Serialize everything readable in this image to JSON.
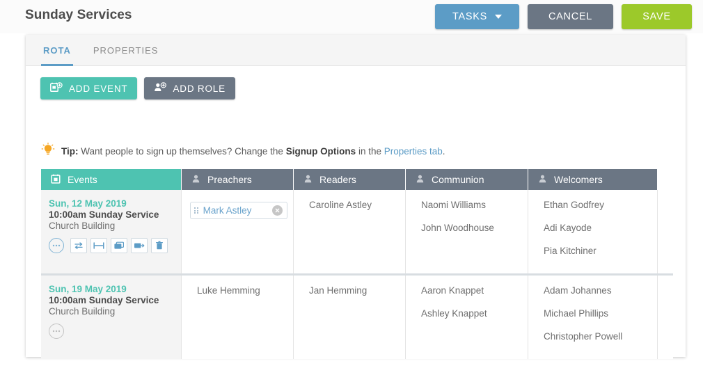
{
  "header": {
    "title": "Sunday Services",
    "buttons": {
      "tasks": "TASKS",
      "cancel": "CANCEL",
      "save": "SAVE"
    }
  },
  "tabs": [
    {
      "label": "ROTA",
      "active": true
    },
    {
      "label": "PROPERTIES",
      "active": false
    }
  ],
  "toolbar": {
    "add_event": "ADD EVENT",
    "add_role": "ADD ROLE"
  },
  "tip": {
    "prefix": "Tip:",
    "text_before": " Want people to sign up themselves? Change the ",
    "bold": "Signup Options",
    "text_middle": " in the ",
    "link": "Properties tab",
    "text_after": "."
  },
  "table": {
    "headers": [
      {
        "label": "Events",
        "icon": "calendar-icon"
      },
      {
        "label": "Preachers",
        "icon": "person-icon"
      },
      {
        "label": "Readers",
        "icon": "person-icon"
      },
      {
        "label": "Communion",
        "icon": "person-icon"
      },
      {
        "label": "Welcomers",
        "icon": "person-icon"
      }
    ],
    "rows": [
      {
        "event": {
          "date": "Sun, 12 May 2019",
          "name": "10:00am Sunday Service",
          "location": "Church Building"
        },
        "preachers_chip": "Mark Astley",
        "readers": [
          "Caroline Astley"
        ],
        "communion": [
          "Naomi Williams",
          "John Woodhouse"
        ],
        "welcomers": [
          "Ethan Godfrey",
          "Adi Kayode",
          "Pia Kitchiner"
        ]
      },
      {
        "event": {
          "date": "Sun, 19 May 2019",
          "name": "10:00am Sunday Service",
          "location": "Church Building"
        },
        "preachers": [
          "Luke Hemming"
        ],
        "readers": [
          "Jan Hemming"
        ],
        "communion": [
          "Aaron Knappet",
          "Ashley Knappet"
        ],
        "welcomers": [
          "Adam Johannes",
          "Michael Phillips",
          "Christopher Powell"
        ]
      }
    ]
  },
  "colors": {
    "teal": "#4ec3b1",
    "blue": "#5c9cc6",
    "slate": "#6b7684",
    "green": "#9cc92a"
  }
}
